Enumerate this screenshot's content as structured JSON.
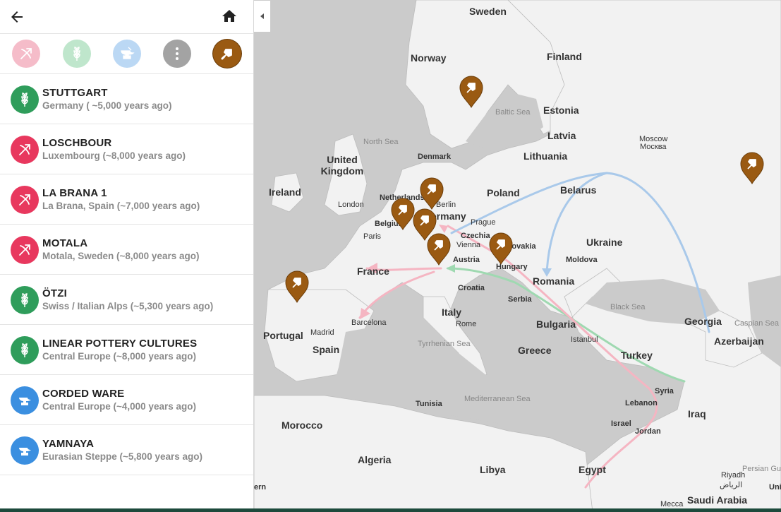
{
  "sidebar": {
    "back_icon": "arrow-left-icon",
    "home_icon": "home-icon",
    "filters": [
      {
        "name": "hunter-gatherer",
        "icon": "bow-icon",
        "color": "#f3b3c3",
        "active": false
      },
      {
        "name": "farmer",
        "icon": "wheat-icon",
        "color": "#b8e3c7",
        "active": false
      },
      {
        "name": "herder",
        "icon": "anvil-icon",
        "color": "#b8d6f3",
        "active": false
      },
      {
        "name": "more",
        "icon": "more-vertical-icon",
        "color": "#a0a0a0",
        "active": false
      },
      {
        "name": "archaeology",
        "icon": "trowel-icon",
        "color": "#9a5a12",
        "active": true
      }
    ],
    "items": [
      {
        "title": "STUTTGART",
        "subtitle": "Germany ( ~5,000 years ago)",
        "type": "farmer",
        "color": "#2f9d5b"
      },
      {
        "title": "LOSCHBOUR",
        "subtitle": "Luxembourg (~8,000 years ago)",
        "type": "hunter",
        "color": "#e8385e"
      },
      {
        "title": "LA BRANA 1",
        "subtitle": "La Brana, Spain (~7,000 years ago)",
        "type": "hunter",
        "color": "#e8385e"
      },
      {
        "title": "MOTALA",
        "subtitle": "Motala, Sweden (~8,000 years ago)",
        "type": "hunter",
        "color": "#e8385e"
      },
      {
        "title": "ÖTZI",
        "subtitle": "Swiss / Italian Alps (~5,300 years ago)",
        "type": "farmer",
        "color": "#2f9d5b"
      },
      {
        "title": "LINEAR POTTERY CULTURES",
        "subtitle": "Central Europe (~8,000 years ago)",
        "type": "farmer",
        "color": "#2f9d5b"
      },
      {
        "title": "CORDED WARE",
        "subtitle": "Central Europe (~4,000 years ago)",
        "type": "herder",
        "color": "#3b8fe0"
      },
      {
        "title": "YAMNAYA",
        "subtitle": "Eurasian Steppe (~5,800 years ago)",
        "type": "herder",
        "color": "#3b8fe0"
      }
    ]
  },
  "map": {
    "countries": [
      "Sweden",
      "Norway",
      "Finland",
      "Estonia",
      "Latvia",
      "Lithuania",
      "Denmark",
      "United Kingdom",
      "Ireland",
      "Netherlands",
      "Belgium",
      "Germany",
      "Poland",
      "Belarus",
      "Czechia",
      "Slovakia",
      "Austria",
      "Hungary",
      "Ukraine",
      "Moldova",
      "Romania",
      "France",
      "Croatia",
      "Serbia",
      "Bulgaria",
      "Italy",
      "Greece",
      "Turkey",
      "Georgia",
      "Azerbaijan",
      "Portugal",
      "Spain",
      "Syria",
      "Lebanon",
      "Israel",
      "Jordan",
      "Iraq",
      "Morocco",
      "Algeria",
      "Tunisia",
      "Libya",
      "Egypt",
      "Saudi Arabia"
    ],
    "cities": [
      "London",
      "Paris",
      "Berlin",
      "Prague",
      "Vienna",
      "Rome",
      "Madrid",
      "Barcelona",
      "Istanbul",
      "Moscow",
      "Москва",
      "Riyadh",
      "الرياض",
      "Mecca"
    ],
    "seas": [
      "Baltic Sea",
      "North Sea",
      "Black Sea",
      "Caspian Sea",
      "Tyrrhenian Sea",
      "Mediterranean Sea",
      "Persian Gu"
    ],
    "partial_labels": [
      "ern",
      "Unit"
    ],
    "route_colors": {
      "hunter": "#f5b5c2",
      "farmer": "#9fd9b1",
      "herder": "#a9c9ea"
    },
    "pin_color": "#9a5a12",
    "pin_icon": "trowel-icon"
  }
}
